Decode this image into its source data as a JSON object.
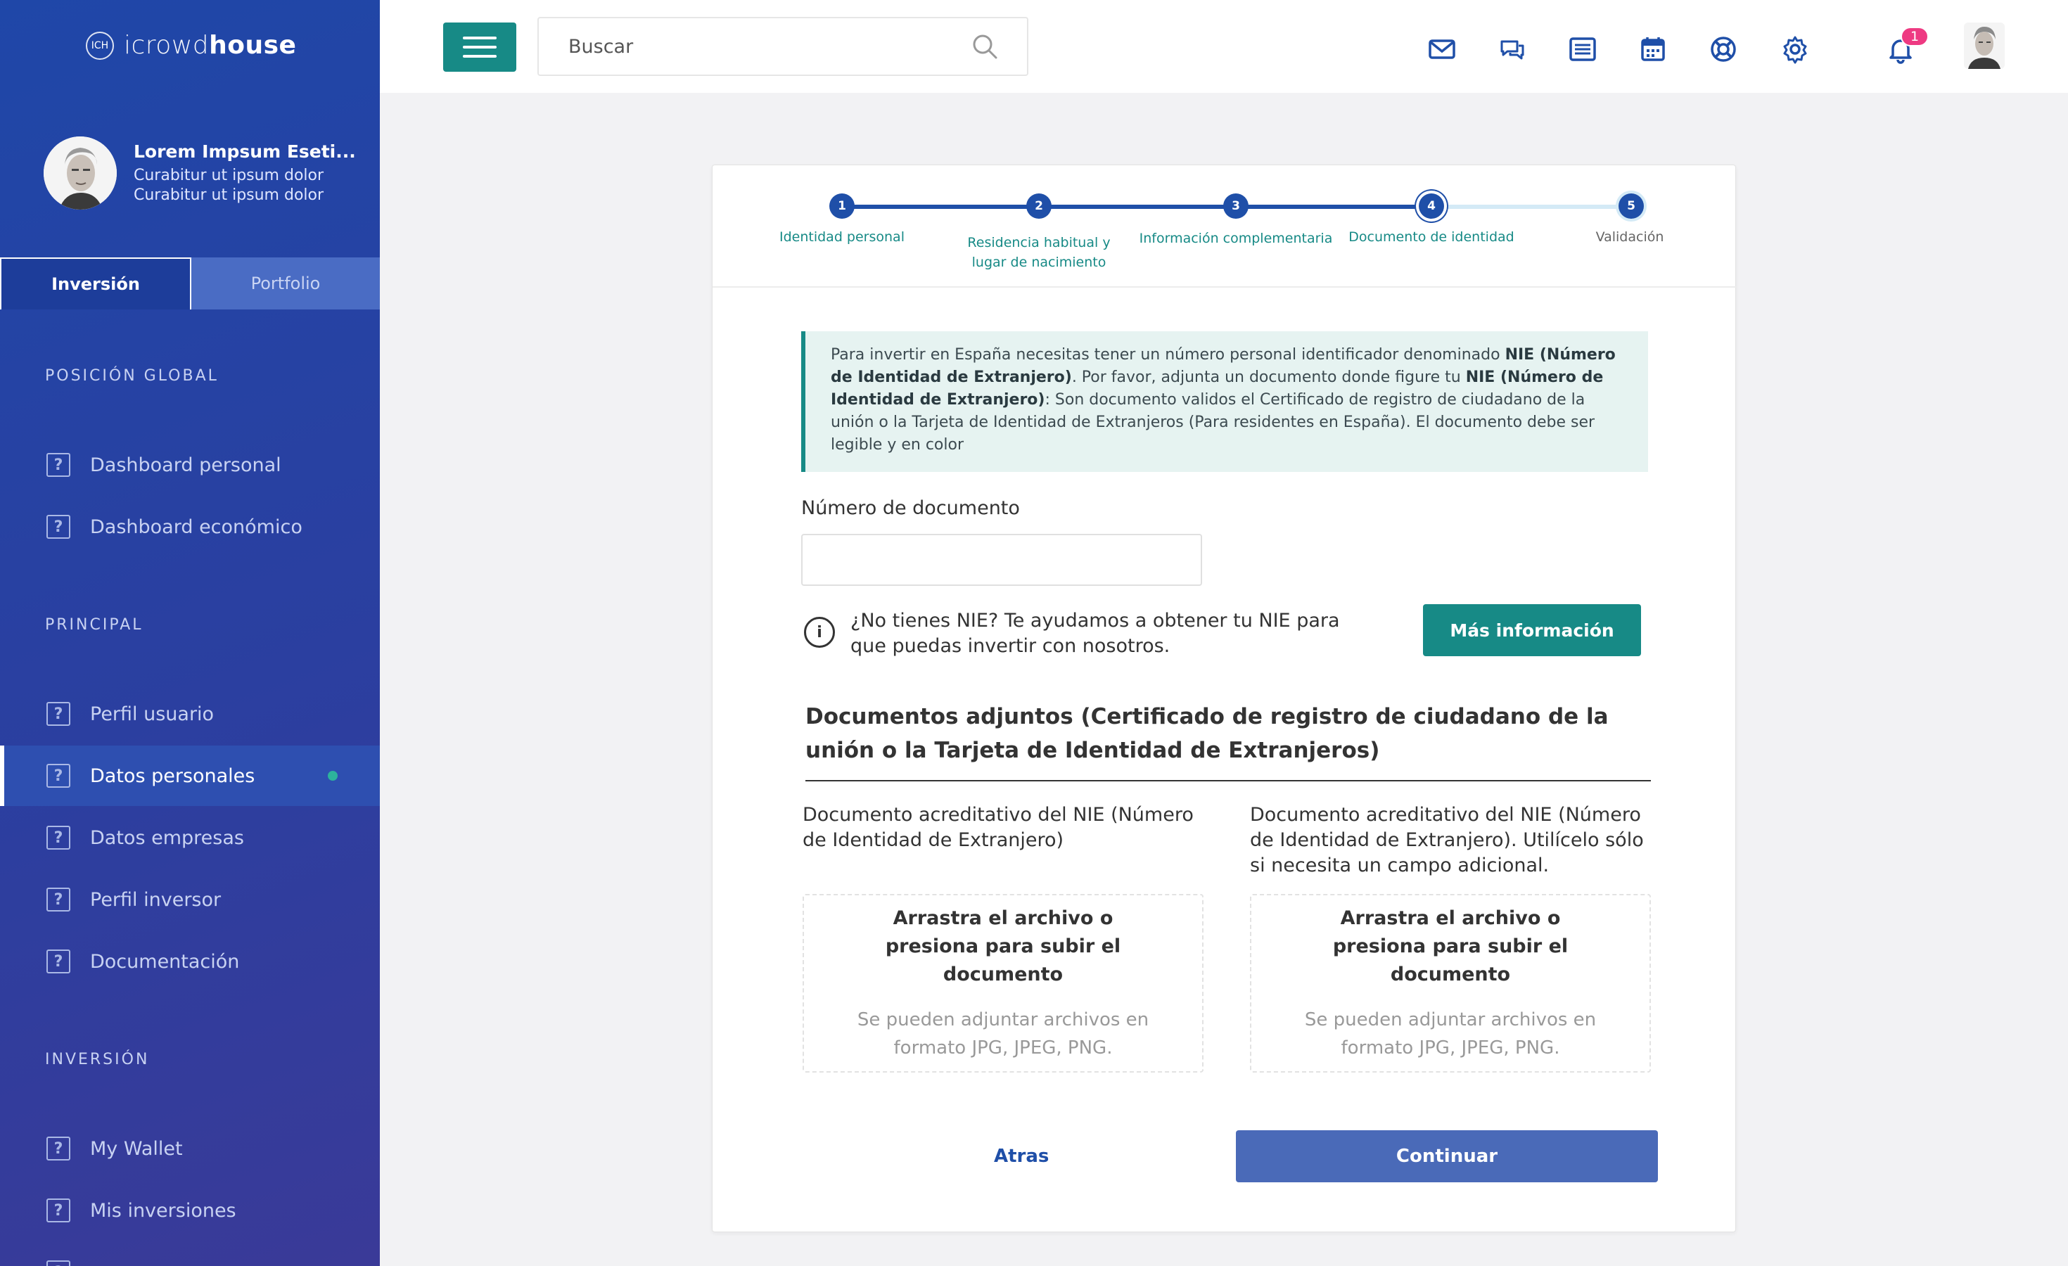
{
  "brand": {
    "mark": "ICH",
    "name_thin": "icrowd",
    "name_bold": "house"
  },
  "profile": {
    "name": "Lorem Impsum Eseti...",
    "line1": "Curabitur ut ipsum dolor",
    "line2": "Curabitur ut ipsum dolor"
  },
  "sidebar_tabs": {
    "active": "Inversión",
    "inactive": "Portfolio"
  },
  "sidebar": {
    "sections": [
      {
        "title": "POSICIÓN GLOBAL",
        "items": [
          "Dashboard personal",
          "Dashboard económico"
        ]
      },
      {
        "title": "PRINCIPAL",
        "items": [
          "Perfil usuario",
          "Datos personales",
          "Datos empresas",
          "Perfil inversor",
          "Documentación"
        ]
      },
      {
        "title": "INVERSIÓN",
        "items": [
          "My Wallet",
          "Mis inversiones"
        ]
      }
    ],
    "active_item": "Datos personales"
  },
  "topbar": {
    "search_placeholder": "Buscar",
    "notification_count": "1",
    "icons": [
      "mail-icon",
      "chat-icon",
      "list-icon",
      "calendar-icon",
      "lifebuoy-icon",
      "gear-icon",
      "bell-icon"
    ]
  },
  "stepper": {
    "steps": [
      {
        "n": "1",
        "label": "Identidad personal"
      },
      {
        "n": "2",
        "label": "Residencia habitual y lugar de nacimiento"
      },
      {
        "n": "3",
        "label": "Información complementaria"
      },
      {
        "n": "4",
        "label": "Documento de identidad"
      },
      {
        "n": "5",
        "label": "Validación"
      }
    ],
    "current": 4
  },
  "notice": {
    "p1": "Para invertir en España necesitas tener un número personal identificador denominado ",
    "b1": "NIE (Número de Identidad de Extranjero)",
    "p2": ". Por favor, adjunta un documento donde figure tu ",
    "b2": "NIE (Número de Identidad de Extranjero)",
    "p3": ": Son documento validos el Certificado de registro de ciudadano de la unión o la Tarjeta de Identidad de Extranjeros (Para residentes en España). El documento debe ser legible y en color"
  },
  "form": {
    "doc_number_label": "Número de documento",
    "doc_number_value": "",
    "nie_help": "¿No tienes NIE? Te ayudamos a obtener tu NIE para que puedas invertir con nosotros.",
    "more_info": "Más información",
    "attach_title": "Documentos adjuntos (Certificado de registro de ciudadano de la unión o la Tarjeta de Identidad de Extranjeros)",
    "col1_title": "Documento acreditativo del NIE (Número de Identidad de Extranjero)",
    "col2_title": "Documento acreditativo del NIE (Número de Identidad de Extranjero). Utilícelo sólo si necesita un campo adicional.",
    "drop_main": "Arrastra el archivo o presiona para subir el documento",
    "drop_hint": "Se pueden adjuntar archivos en formato JPG, JPEG, PNG.",
    "back": "Atras",
    "continue": "Continuar"
  },
  "colors": {
    "sidebar": "#2b3fa0",
    "teal": "#178a86",
    "primary": "#1f4fa8",
    "badge": "#ee3a82"
  }
}
